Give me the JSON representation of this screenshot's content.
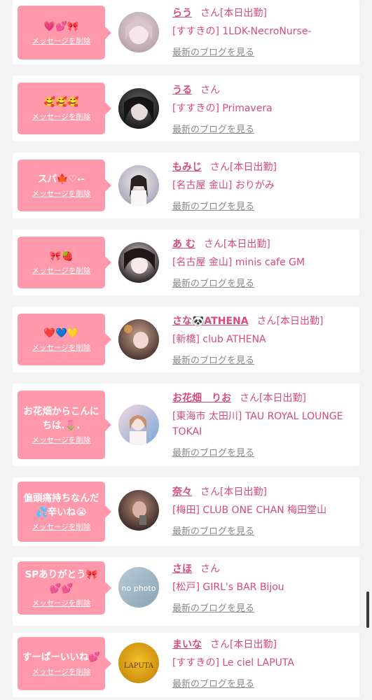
{
  "entries": [
    {
      "message": "💗💕🎀",
      "delete_label": "メッセージを削除",
      "name": "らう",
      "san": "さん",
      "status": "[本日出勤]",
      "shop": "[すすきの] 1LDK-NecroNurse-",
      "blog": "最新のブログを見る",
      "avatar_colors": [
        "#e8d6dc",
        "#b7a2ab"
      ]
    },
    {
      "message": "🥰🥰🥰",
      "delete_label": "メッセージを削除",
      "name": "うる",
      "san": "さん",
      "status": "",
      "shop": "[すすきの] Primavera",
      "blog": "最新のブログを見る",
      "avatar_colors": [
        "#6a6a6a",
        "#1a1a1a"
      ]
    },
    {
      "message": "スパ🍁♡˖-",
      "delete_label": "メッセージを削除",
      "name": "もみじ",
      "san": "さん",
      "status": "[本日出勤]",
      "shop": "[名古屋 金山] おりがみ",
      "blog": "最新のブログを見る",
      "avatar_colors": [
        "#f2eef0",
        "#a9a6b8"
      ]
    },
    {
      "message": "🎀🍓",
      "delete_label": "メッセージを削除",
      "name": "あ む",
      "san": "さん",
      "status": "[本日出勤]",
      "shop": "[名古屋 金山] minis cafe GM",
      "blog": "最新のブログを見る",
      "avatar_colors": [
        "#f0e4e6",
        "#2c2426"
      ]
    },
    {
      "message": "❤️💙💛",
      "delete_label": "メッセージを削除",
      "name": "さな🐼ATHENA",
      "san": "さん",
      "status": "[本日出勤]",
      "shop": "[新橋] club ATHENA",
      "blog": "最新のブログを見る",
      "avatar_colors": [
        "#c9a38f",
        "#4a3530"
      ]
    },
    {
      "message": "お花畑からこんにちは.🌷.",
      "delete_label": "メッセージを削除",
      "name": "お花畑　りお",
      "san": "さん",
      "status": "[本日出勤]",
      "shop": "[東海市 太田川] TAU ROYAL LOUNGE TOKAI",
      "blog": "最新のブログを見る",
      "avatar_colors": [
        "#f4d6dc",
        "#7aa7d8"
      ]
    },
    {
      "message": "偏頭痛持ちなんだ💦辛いね😭",
      "delete_label": "メッセージを削除",
      "name": "奈々",
      "san": "さん",
      "status": "[本日出勤]",
      "shop": "[梅田] CLUB ONE CHAN 梅田堂山",
      "blog": "最新のブログを見る",
      "avatar_colors": [
        "#b88a7a",
        "#3b2a26"
      ]
    },
    {
      "message": "SPありがとう🎀💕💕",
      "delete_label": "メッセージを削除",
      "name": "さほ",
      "san": "さん",
      "status": "",
      "shop": "[松戸] GIRL's BAR Bijou",
      "blog": "最新のブログを見る",
      "avatar_colors": [
        "#b8cad6",
        "#8aa4b4"
      ],
      "avatar_text": "no photo"
    },
    {
      "message": "すーぱーいいね💕",
      "delete_label": "メッセージを削除",
      "name": "まいな",
      "san": "さん",
      "status": "[本日出勤]",
      "shop": "[すすきの] Le ciel LAPUTA",
      "blog": "最新のブログを見る",
      "avatar_colors": [
        "#f5c02a",
        "#c98a0c"
      ],
      "avatar_text": "LAPUTA"
    }
  ],
  "theme": {
    "accent": "#ff98aa",
    "name_color": "#d94a7a",
    "link_gray": "#8a8a8a"
  }
}
